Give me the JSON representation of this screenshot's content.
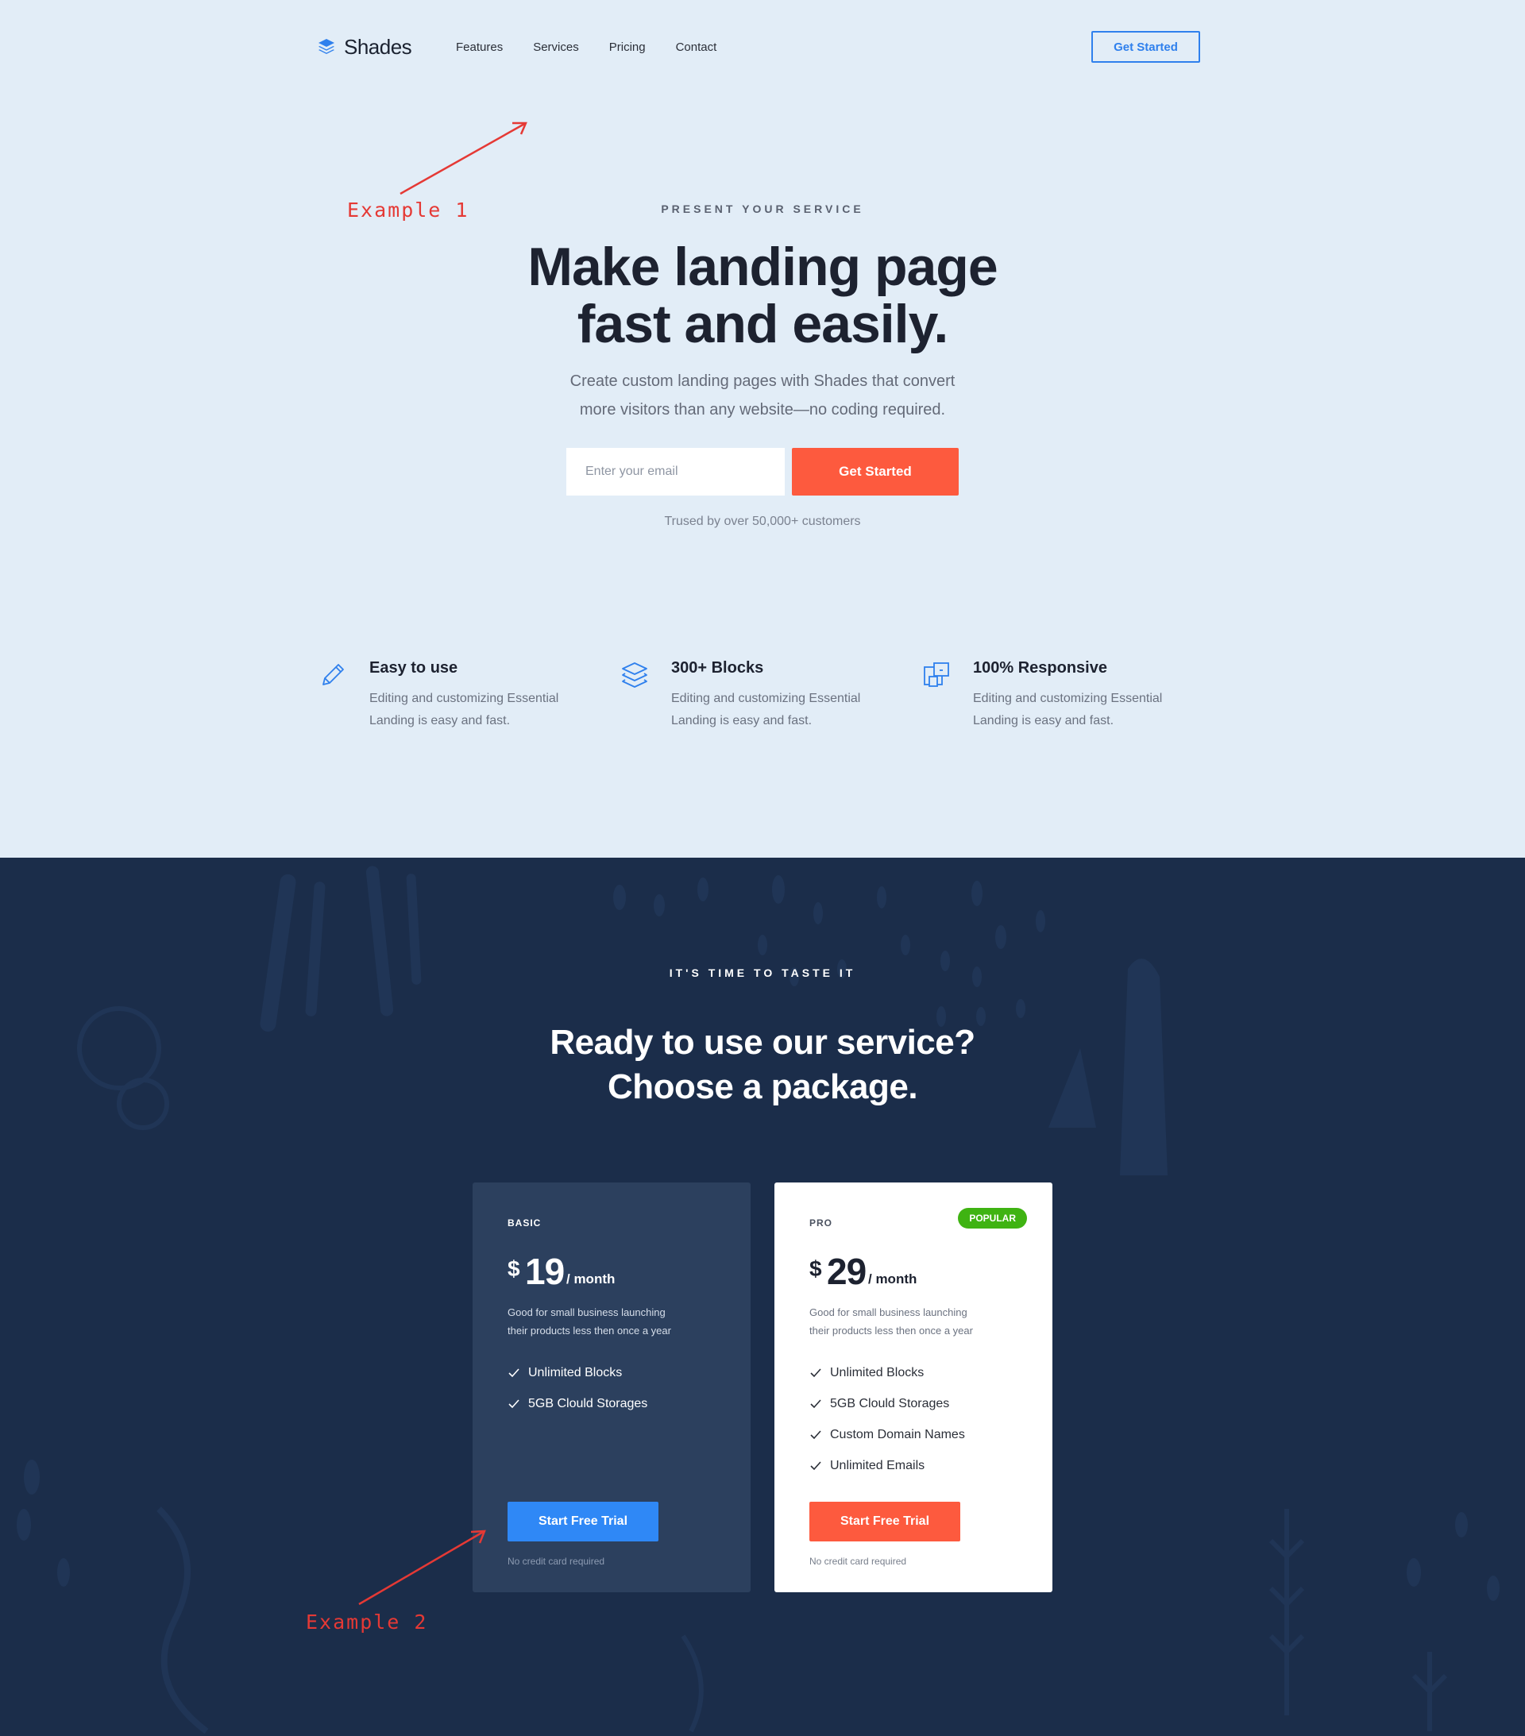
{
  "nav": {
    "brand": "Shades",
    "links": [
      "Features",
      "Services",
      "Pricing",
      "Contact"
    ],
    "cta": "Get Started"
  },
  "annotations": {
    "example1": "Example 1",
    "example2": "Example 2",
    "color": "#e53935"
  },
  "hero": {
    "eyebrow": "PRESENT YOUR SERVICE",
    "title_line1": "Make landing page",
    "title_line2": "fast and easily.",
    "subtitle_line1": "Create custom landing pages with Shades that convert",
    "subtitle_line2": "more visitors than any website—no coding required.",
    "email_placeholder": "Enter your email",
    "email_value": "",
    "button": "Get Started",
    "trusted": "Trused by over 50,000+ customers"
  },
  "features": [
    {
      "icon": "pencil-icon",
      "title": "Easy to use",
      "desc_line1": "Editing and customizing Essential",
      "desc_line2": "Landing is easy and fast."
    },
    {
      "icon": "layers-icon",
      "title": "300+ Blocks",
      "desc_line1": "Editing and customizing Essential",
      "desc_line2": "Landing is easy and fast."
    },
    {
      "icon": "devices-icon",
      "title": "100% Responsive",
      "desc_line1": "Editing and customizing Essential",
      "desc_line2": "Landing is easy and fast."
    }
  ],
  "pricing": {
    "eyebrow": "IT'S TIME TO TASTE IT",
    "title_line1": "Ready to use our service?",
    "title_line2": "Choose a package.",
    "plans": [
      {
        "tier": "BASIC",
        "currency": "$",
        "amount": "19",
        "period": "/ month",
        "desc_line1": "Good for small business launching",
        "desc_line2": "their products less then once a year",
        "features": [
          "Unlimited Blocks",
          "5GB Clould Storages"
        ],
        "button": "Start Free Trial",
        "note": "No credit card required"
      },
      {
        "tier": "PRO",
        "badge": "POPULAR",
        "currency": "$",
        "amount": "29",
        "period": "/ month",
        "desc_line1": "Good for small business launching",
        "desc_line2": "their products less then once a year",
        "features": [
          "Unlimited Blocks",
          "5GB Clould Storages",
          "Custom Domain Names",
          "Unlimited Emails"
        ],
        "button": "Start Free Trial",
        "note": "No credit card required"
      }
    ]
  },
  "colors": {
    "hero_bg": "#e2edf7",
    "pricing_bg": "#1b2d4a",
    "accent_blue": "#2f80ed",
    "accent_orange": "#fd5a3e",
    "popular_green": "#3fb312"
  }
}
